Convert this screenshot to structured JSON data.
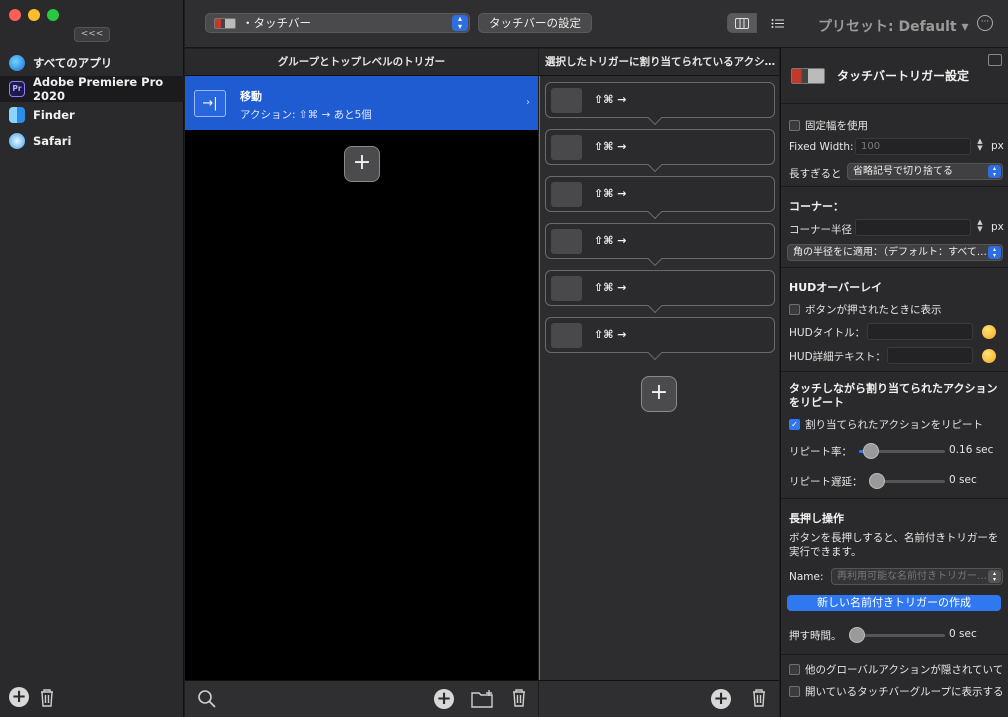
{
  "window": {
    "collapse_label": "<<<"
  },
  "sidebar": {
    "items": [
      {
        "label": "すべてのアプリ",
        "icon": "all-apps-icon"
      },
      {
        "label": "Adobe Premiere Pro 2020",
        "icon": "premiere-icon",
        "icon_text": "Pr",
        "selected": true
      },
      {
        "label": "Finder",
        "icon": "finder-icon"
      },
      {
        "label": "Safari",
        "icon": "safari-icon"
      }
    ]
  },
  "toolbar": {
    "type_select": "・タッチバー",
    "settings_button": "タッチバーの設定",
    "preset_label": "プリセット: Default ▾"
  },
  "groups_column": {
    "header": "グループとトップレベルのトリガー",
    "trigger": {
      "title": "移動",
      "subtitle": "アクション: ⇧⌘ → あと5個"
    }
  },
  "actions_column": {
    "header": "選択したトリガーに割り当てられているアクシ…",
    "actions": [
      "⇧⌘ →",
      "⇧⌘ →",
      "⇧⌘ →",
      "⇧⌘ →",
      "⇧⌘ →",
      "⇧⌘ →"
    ]
  },
  "inspector": {
    "title": "タッチバートリガー設定",
    "fixed_width_checkbox": "固定幅を使用",
    "fixed_width_label": "Fixed Width:",
    "fixed_width_placeholder": "100",
    "px_unit": "px",
    "too_long_label": "長すぎると",
    "too_long_value": "省略記号で切り捨てる",
    "corner_title": "コーナー：",
    "corner_radius_label": "コーナー半径",
    "corner_apply_value": "角の半径をに適用：（デフォルト：すべて…",
    "hud_title": "HUDオーバーレイ",
    "hud_show_checkbox": "ボタンが押されたときに表示",
    "hud_title_label": "HUDタイトル：",
    "hud_detail_label": "HUD詳細テキスト：",
    "repeat_title": "タッチしながら割り当てられたアクションをリピート",
    "repeat_checkbox": "割り当てられたアクションをリピート",
    "repeat_rate_label": "リピート率：",
    "repeat_rate_value": "0.16 sec",
    "repeat_rate_level": 0.06,
    "repeat_delay_label": "リピート遅延：",
    "repeat_delay_value": "0 sec",
    "repeat_delay_level": 0.0,
    "long_press_title": "長押し操作",
    "long_press_desc": "ボタンを長押しすると、名前付きトリガーを実行できます。",
    "name_label": "Name:",
    "name_placeholder": "再利用可能な名前付きトリガー…",
    "create_button": "新しい名前付きトリガーの作成",
    "press_time_label": "押す時間。",
    "press_time_value": "0 sec",
    "press_time_level": 0.0,
    "global_checkbox": "他のグローバルアクションが隠されていて",
    "open_group_checkbox": "開いているタッチバーグループに表示する"
  },
  "colors": {
    "accent": "#2f78f0",
    "selection": "#1f5bd1"
  }
}
